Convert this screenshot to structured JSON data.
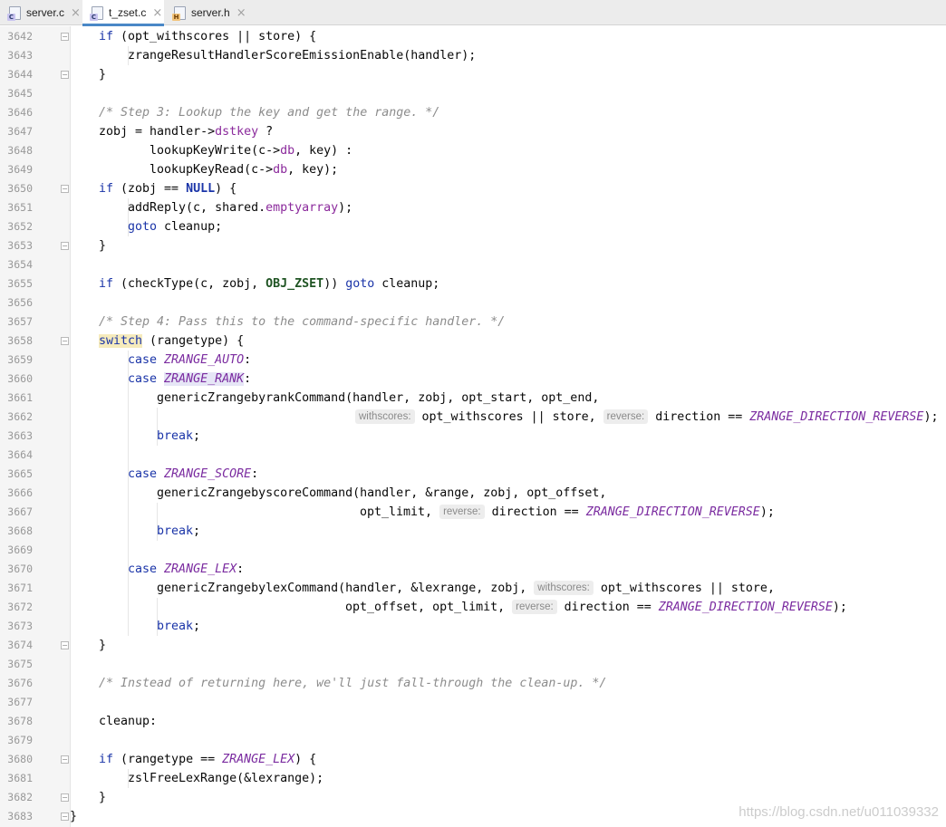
{
  "tabs": [
    {
      "name": "server.c",
      "type": "c",
      "active": false
    },
    {
      "name": "t_zset.c",
      "type": "c",
      "active": true
    },
    {
      "name": "server.h",
      "type": "h",
      "active": false
    }
  ],
  "icons": {
    "close": "close-icon",
    "c_file": "c-file-icon",
    "h_file": "h-file-icon",
    "fold": "fold-marker-icon"
  },
  "colors": {
    "keyword": "#1a34a8",
    "comment": "#8c8c8c",
    "enum": "#7b2ca0",
    "active_tab": "#4a88c7"
  },
  "line_numbers": [
    "3642",
    "3643",
    "3644",
    "3645",
    "3646",
    "3647",
    "3648",
    "3649",
    "3650",
    "3651",
    "3652",
    "3653",
    "3654",
    "3655",
    "3656",
    "3657",
    "3658",
    "3659",
    "3660",
    "3661",
    "3662",
    "3663",
    "3664",
    "3665",
    "3666",
    "3667",
    "3668",
    "3669",
    "3670",
    "3671",
    "3672",
    "3673",
    "3674",
    "3675",
    "3676",
    "3677",
    "3678",
    "3679",
    "3680",
    "3681",
    "3682",
    "3683"
  ],
  "code": {
    "l3642": {
      "t1": "if",
      "t2": " (opt_withscores || store) {"
    },
    "l3643": {
      "t1": "zrangeResultHandlerScoreEmissionEnable(handler);"
    },
    "l3644": {
      "t1": "}"
    },
    "l3646": {
      "t1": "/* Step 3: Lookup the key and get the range. */"
    },
    "l3647": {
      "t1": "zobj = handler->",
      "t2": "dstkey",
      "t3": " ?"
    },
    "l3648": {
      "t1": "lookupKeyWrite(c->",
      "t2": "db",
      "t3": ", key) :"
    },
    "l3649": {
      "t1": "lookupKeyRead(c->",
      "t2": "db",
      "t3": ", key);"
    },
    "l3650": {
      "t1": "if",
      "t2": " (zobj == ",
      "t3": "NULL",
      "t4": ") {"
    },
    "l3651": {
      "t1": "addReply(c, shared.",
      "t2": "emptyarray",
      "t3": ");"
    },
    "l3652": {
      "t1": "goto",
      "t2": " cleanup;"
    },
    "l3653": {
      "t1": "}"
    },
    "l3655": {
      "t1": "if",
      "t2": " (checkType(c, zobj, ",
      "t3": "OBJ_ZSET",
      "t4": ")) ",
      "t5": "goto",
      "t6": " cleanup;"
    },
    "l3657": {
      "t1": "/* Step 4: Pass this to the command-specific handler. */"
    },
    "l3658": {
      "t1": "switch",
      "t2": " (rangetype) {"
    },
    "l3659": {
      "t1": "case",
      "t2": " ",
      "t3": "ZRANGE_AUTO",
      "t4": ":"
    },
    "l3660": {
      "t1": "case",
      "t2": " ",
      "t3": "ZRANGE_RANK",
      "t4": ":"
    },
    "l3661": {
      "t1": "genericZrangebyrankCommand(handler, zobj, opt_start, opt_end,"
    },
    "l3662": {
      "h1": "withscores:",
      "t1": " opt_withscores || store, ",
      "h2": "reverse:",
      "t2": " direction == ",
      "t3": "ZRANGE_DIRECTION_REVERSE",
      "t4": ");"
    },
    "l3663": {
      "t1": "break",
      "t2": ";"
    },
    "l3665": {
      "t1": "case",
      "t2": " ",
      "t3": "ZRANGE_SCORE",
      "t4": ":"
    },
    "l3666": {
      "t1": "genericZrangebyscoreCommand(handler, &range, zobj, opt_offset,"
    },
    "l3667": {
      "t1": "opt_limit, ",
      "h1": "reverse:",
      "t2": " direction == ",
      "t3": "ZRANGE_DIRECTION_REVERSE",
      "t4": ");"
    },
    "l3668": {
      "t1": "break",
      "t2": ";"
    },
    "l3670": {
      "t1": "case",
      "t2": " ",
      "t3": "ZRANGE_LEX",
      "t4": ":"
    },
    "l3671": {
      "t1": "genericZrangebylexCommand(handler, &lexrange, zobj, ",
      "h1": "withscores:",
      "t2": " opt_withscores || store,"
    },
    "l3672": {
      "t1": "opt_offset, opt_limit, ",
      "h1": "reverse:",
      "t2": " direction == ",
      "t3": "ZRANGE_DIRECTION_REVERSE",
      "t4": ");"
    },
    "l3673": {
      "t1": "break",
      "t2": ";"
    },
    "l3674": {
      "t1": "}"
    },
    "l3676": {
      "t1": "/* Instead of returning here, we'll just fall-through the clean-up. */"
    },
    "l3678": {
      "t1": "cleanup:"
    },
    "l3680": {
      "t1": "if",
      "t2": " (rangetype == ",
      "t3": "ZRANGE_LEX",
      "t4": ") {"
    },
    "l3681": {
      "t1": "zslFreeLexRange(&lexrange);"
    },
    "l3682": {
      "t1": "}"
    },
    "l3683": {
      "t1": "}"
    }
  },
  "watermark": "https://blog.csdn.net/u011039332"
}
